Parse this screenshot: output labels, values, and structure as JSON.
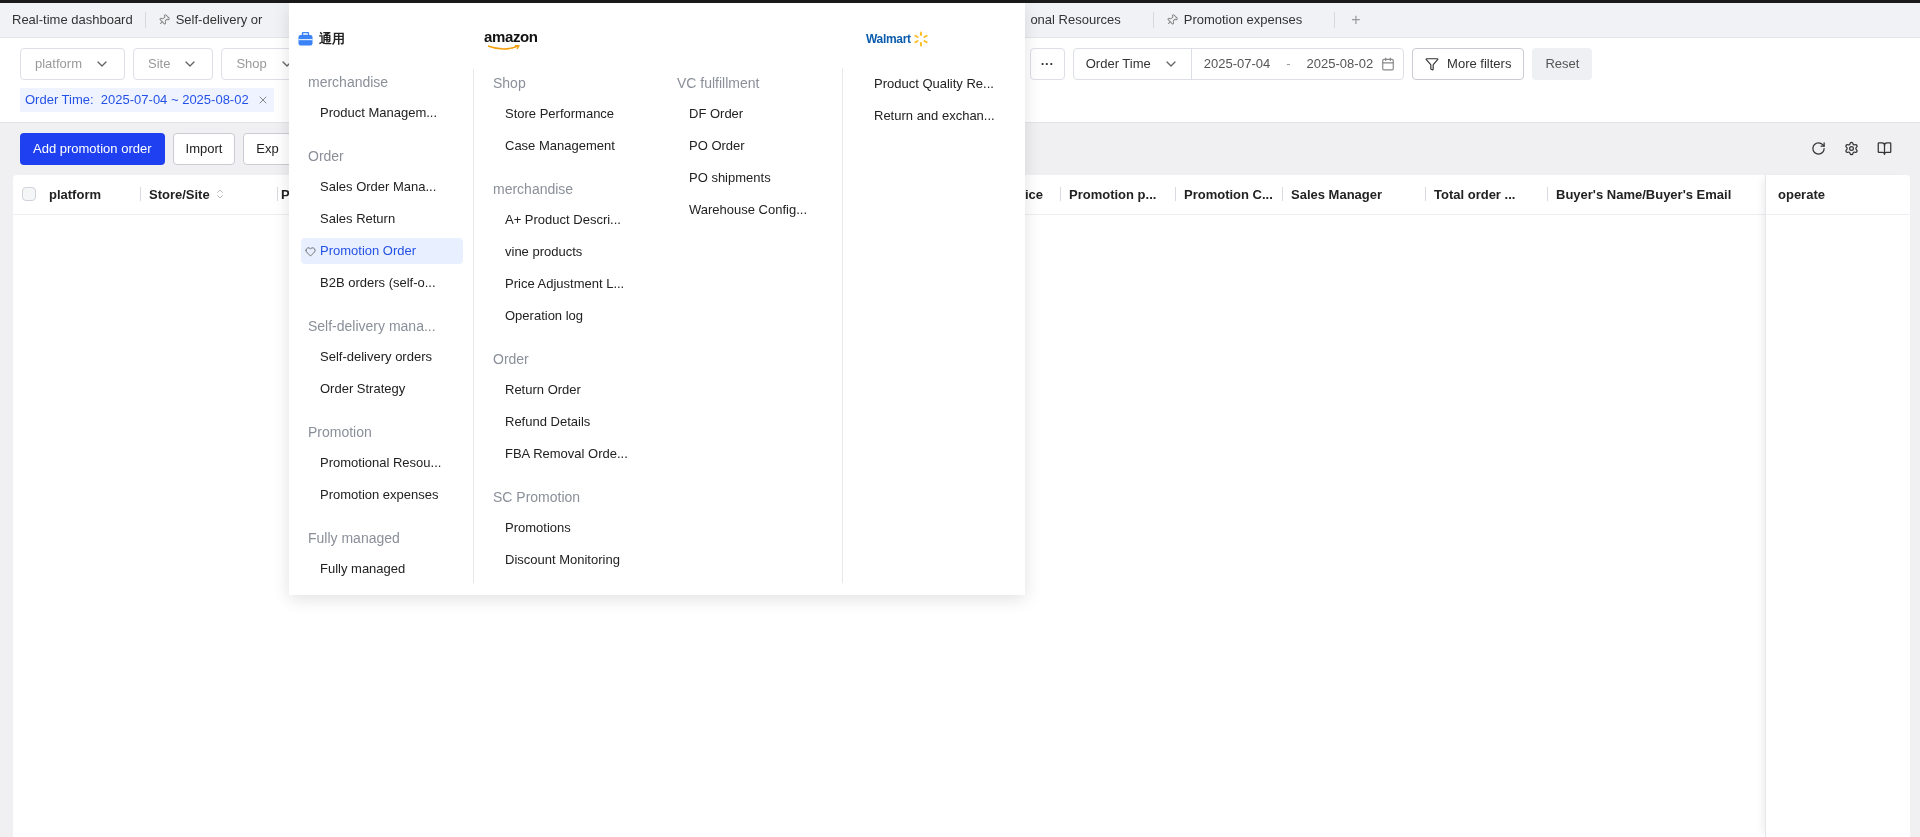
{
  "tabs": [
    {
      "label": "Real-time dashboard",
      "pinned": false
    },
    {
      "label": "Self-delivery or",
      "pinned": true
    }
  ],
  "tabs_right": [
    {
      "label": "onal Resources",
      "pinned": false
    },
    {
      "label": "Promotion expenses",
      "pinned": true
    }
  ],
  "add_tab": "+",
  "filters_left": [
    {
      "placeholder": "platform"
    },
    {
      "placeholder": "Site"
    },
    {
      "placeholder": "Shop"
    }
  ],
  "more_button": "···",
  "date_filter": {
    "field": "Order Time",
    "start": "2025-07-04",
    "separator": "-",
    "end": "2025-08-02"
  },
  "more_filters": "More filters",
  "reset": "Reset",
  "active_filter": "Order Time:  2025-07-04 ~ 2025-08-02",
  "toolbar_buttons": [
    {
      "label": "Add promotion order",
      "kind": "primary"
    },
    {
      "label": "Import",
      "kind": "default"
    },
    {
      "label": "Exp",
      "kind": "default"
    }
  ],
  "table": {
    "select_all": {
      "checked": false
    },
    "columns_left": [
      {
        "label": "platform",
        "sortable": false
      },
      {
        "label": "Store/Site",
        "sortable": true
      },
      {
        "label": "P"
      }
    ],
    "columns_right": [
      {
        "label": "ice"
      },
      {
        "label": "Promotion p..."
      },
      {
        "label": "Promotion C..."
      },
      {
        "label": "Sales Manager"
      },
      {
        "label": "Total order ..."
      },
      {
        "label": "Buyer's Name/Buyer's Email"
      }
    ],
    "fixed_column": "operate"
  },
  "menu": {
    "sections": [
      {
        "kind": "general",
        "label": "通用",
        "columns": [
          [
            {
              "title": "merchandise",
              "items": [
                {
                  "label": "Product Managem...",
                  "selected": false
                }
              ]
            },
            {
              "title": "Order",
              "items": [
                {
                  "label": "Sales Order Mana...",
                  "selected": false
                },
                {
                  "label": "Sales Return",
                  "selected": false
                },
                {
                  "label": "Promotion Order",
                  "selected": true
                },
                {
                  "label": "B2B orders (self-o...",
                  "selected": false
                }
              ]
            },
            {
              "title": "Self-delivery mana...",
              "items": [
                {
                  "label": "Self-delivery orders",
                  "selected": false
                },
                {
                  "label": "Order Strategy",
                  "selected": false
                }
              ]
            },
            {
              "title": "Promotion",
              "items": [
                {
                  "label": "Promotional Resou...",
                  "selected": false
                },
                {
                  "label": "Promotion expenses",
                  "selected": false
                }
              ]
            },
            {
              "title": "Fully managed",
              "items": [
                {
                  "label": "Fully managed",
                  "selected": false
                }
              ]
            }
          ]
        ]
      },
      {
        "kind": "amazon",
        "label": "amazon",
        "columns": [
          [
            {
              "title": "Shop",
              "items": [
                {
                  "label": "Store Performance",
                  "selected": false
                },
                {
                  "label": "Case Management",
                  "selected": false
                }
              ]
            },
            {
              "title": "merchandise",
              "items": [
                {
                  "label": "A+ Product Descri...",
                  "selected": false
                },
                {
                  "label": "vine products",
                  "selected": false
                },
                {
                  "label": "Price Adjustment L...",
                  "selected": false
                },
                {
                  "label": "Operation log",
                  "selected": false
                }
              ]
            },
            {
              "title": "Order",
              "items": [
                {
                  "label": "Return Order",
                  "selected": false
                },
                {
                  "label": "Refund Details",
                  "selected": false
                },
                {
                  "label": "FBA Removal Orde...",
                  "selected": false
                }
              ]
            },
            {
              "title": "SC Promotion",
              "items": [
                {
                  "label": "Promotions",
                  "selected": false
                },
                {
                  "label": "Discount Monitoring",
                  "selected": false
                }
              ]
            }
          ],
          [
            {
              "title": "VC fulfillment",
              "items": [
                {
                  "label": "DF Order",
                  "selected": false
                },
                {
                  "label": "PO Order",
                  "selected": false
                },
                {
                  "label": "PO shipments",
                  "selected": false
                },
                {
                  "label": "Warehouse Config...",
                  "selected": false
                }
              ]
            }
          ]
        ]
      },
      {
        "kind": "walmart",
        "label": "Walmart",
        "columns": [
          [
            {
              "items": [
                {
                  "label": "Product Quality Re...",
                  "selected": false
                },
                {
                  "label": "Return and exchan...",
                  "selected": false
                }
              ]
            }
          ]
        ]
      }
    ]
  }
}
